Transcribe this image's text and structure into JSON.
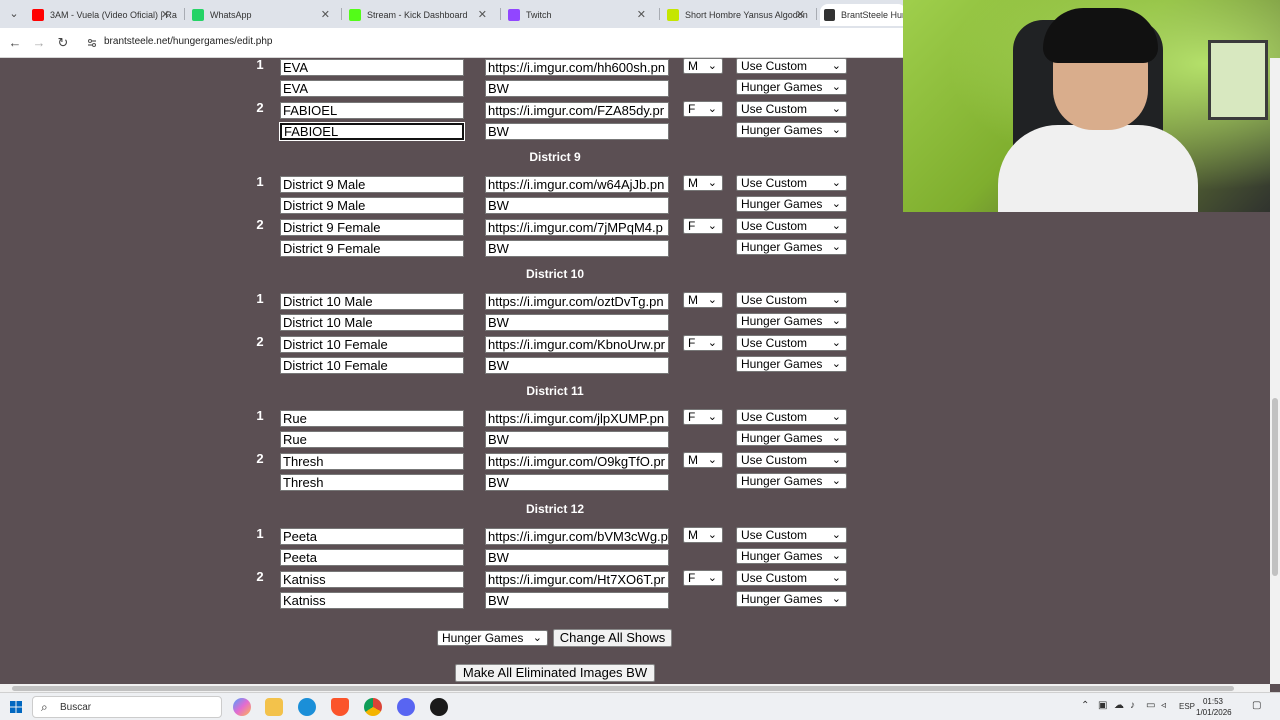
{
  "browser": {
    "tabs": [
      {
        "title": "3AM - Vuela (Video Oficial) | Ra",
        "color": "#ff0000"
      },
      {
        "title": "WhatsApp",
        "color": "#25d366"
      },
      {
        "title": "Stream - Kick Dashboard",
        "color": "#53fc18"
      },
      {
        "title": "Twitch",
        "color": "#9146ff"
      },
      {
        "title": "Short Hombre Yansus Algodon",
        "color": "#c5e600"
      },
      {
        "title": "BrantSteele Hung",
        "color": "#333333"
      }
    ],
    "url": "brantsteele.net/hungergames/edit.php"
  },
  "top_rows": [
    {
      "num": "1",
      "name": "EVA",
      "img": "https://i.imgur.com/hh600sh.pn",
      "gender": "M",
      "imgsel": "Use Custom"
    },
    {
      "num": "",
      "name": "EVA",
      "img": "BW",
      "gender": "",
      "imgsel": "Hunger Games"
    },
    {
      "num": "2",
      "name": "FABIOEL",
      "img": "https://i.imgur.com/FZA85dy.pr",
      "gender": "F",
      "imgsel": "Use Custom"
    },
    {
      "num": "",
      "name": "FABIOEL",
      "img": "BW",
      "gender": "",
      "imgsel": "Hunger Games"
    }
  ],
  "districts": [
    {
      "title": "District 9",
      "rows": [
        {
          "num": "1",
          "name": "District 9 Male",
          "img": "https://i.imgur.com/w64AjJb.pn",
          "gender": "M",
          "imgsel": "Use Custom"
        },
        {
          "num": "",
          "name": "District 9 Male",
          "img": "BW",
          "gender": "",
          "imgsel": "Hunger Games"
        },
        {
          "num": "2",
          "name": "District 9 Female",
          "img": "https://i.imgur.com/7jMPqM4.p",
          "gender": "F",
          "imgsel": "Use Custom"
        },
        {
          "num": "",
          "name": "District 9 Female",
          "img": "BW",
          "gender": "",
          "imgsel": "Hunger Games"
        }
      ]
    },
    {
      "title": "District 10",
      "rows": [
        {
          "num": "1",
          "name": "District 10 Male",
          "img": "https://i.imgur.com/oztDvTg.pn",
          "gender": "M",
          "imgsel": "Use Custom"
        },
        {
          "num": "",
          "name": "District 10 Male",
          "img": "BW",
          "gender": "",
          "imgsel": "Hunger Games"
        },
        {
          "num": "2",
          "name": "District 10 Female",
          "img": "https://i.imgur.com/KbnoUrw.pr",
          "gender": "F",
          "imgsel": "Use Custom"
        },
        {
          "num": "",
          "name": "District 10 Female",
          "img": "BW",
          "gender": "",
          "imgsel": "Hunger Games"
        }
      ]
    },
    {
      "title": "District 11",
      "rows": [
        {
          "num": "1",
          "name": "Rue",
          "img": "https://i.imgur.com/jlpXUMP.pn",
          "gender": "F",
          "imgsel": "Use Custom"
        },
        {
          "num": "",
          "name": "Rue",
          "img": "BW",
          "gender": "",
          "imgsel": "Hunger Games"
        },
        {
          "num": "2",
          "name": "Thresh",
          "img": "https://i.imgur.com/O9kgTfO.pr",
          "gender": "M",
          "imgsel": "Use Custom"
        },
        {
          "num": "",
          "name": "Thresh",
          "img": "BW",
          "gender": "",
          "imgsel": "Hunger Games"
        }
      ]
    },
    {
      "title": "District 12",
      "rows": [
        {
          "num": "1",
          "name": "Peeta",
          "img": "https://i.imgur.com/bVM3cWg.p",
          "gender": "M",
          "imgsel": "Use Custom"
        },
        {
          "num": "",
          "name": "Peeta",
          "img": "BW",
          "gender": "",
          "imgsel": "Hunger Games"
        },
        {
          "num": "2",
          "name": "Katniss",
          "img": "https://i.imgur.com/Ht7XO6T.pr",
          "gender": "F",
          "imgsel": "Use Custom"
        },
        {
          "num": "",
          "name": "Katniss",
          "img": "BW",
          "gender": "",
          "imgsel": "Hunger Games"
        }
      ]
    }
  ],
  "footer": {
    "show_select": "Hunger Games",
    "change_all_label": "Change All Shows",
    "make_bw_label": "Make All Eliminated Images BW"
  },
  "taskbar": {
    "search_placeholder": "Buscar",
    "lang": "ESP",
    "time": "01:53",
    "date": "1/01/2026"
  }
}
